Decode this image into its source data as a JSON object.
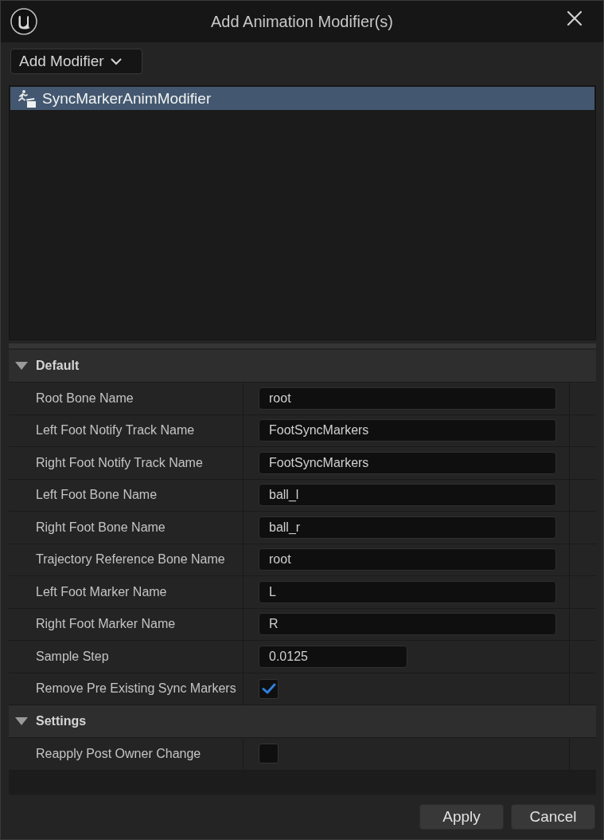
{
  "window": {
    "title": "Add Animation Modifier(s)"
  },
  "toolbar": {
    "add_button": "Add Modifier"
  },
  "modifier_list": {
    "items": [
      {
        "label": "SyncMarkerAnimModifier",
        "selected": true
      }
    ]
  },
  "details": {
    "categories": [
      {
        "label": "Default",
        "expanded": true,
        "properties": [
          {
            "label": "Root Bone Name",
            "kind": "text",
            "value": "root"
          },
          {
            "label": "Left Foot Notify Track Name",
            "kind": "text",
            "value": "FootSyncMarkers"
          },
          {
            "label": "Right Foot Notify Track Name",
            "kind": "text",
            "value": "FootSyncMarkers"
          },
          {
            "label": "Left Foot Bone Name",
            "kind": "text",
            "value": "ball_l"
          },
          {
            "label": "Right Foot Bone Name",
            "kind": "text",
            "value": "ball_r"
          },
          {
            "label": "Trajectory Reference Bone Name",
            "kind": "text",
            "value": "root"
          },
          {
            "label": "Left Foot Marker Name",
            "kind": "text",
            "value": "L"
          },
          {
            "label": "Right Foot Marker Name",
            "kind": "text",
            "value": "R"
          },
          {
            "label": "Sample Step",
            "kind": "number",
            "value": "0.0125"
          },
          {
            "label": "Remove Pre Existing Sync Markers",
            "kind": "checkbox",
            "checked": true
          }
        ]
      },
      {
        "label": "Settings",
        "expanded": true,
        "properties": [
          {
            "label": "Reapply Post Owner Change",
            "kind": "checkbox",
            "checked": false
          }
        ]
      }
    ]
  },
  "buttons": [
    {
      "label": "Apply"
    },
    {
      "label": "Cancel"
    }
  ]
}
